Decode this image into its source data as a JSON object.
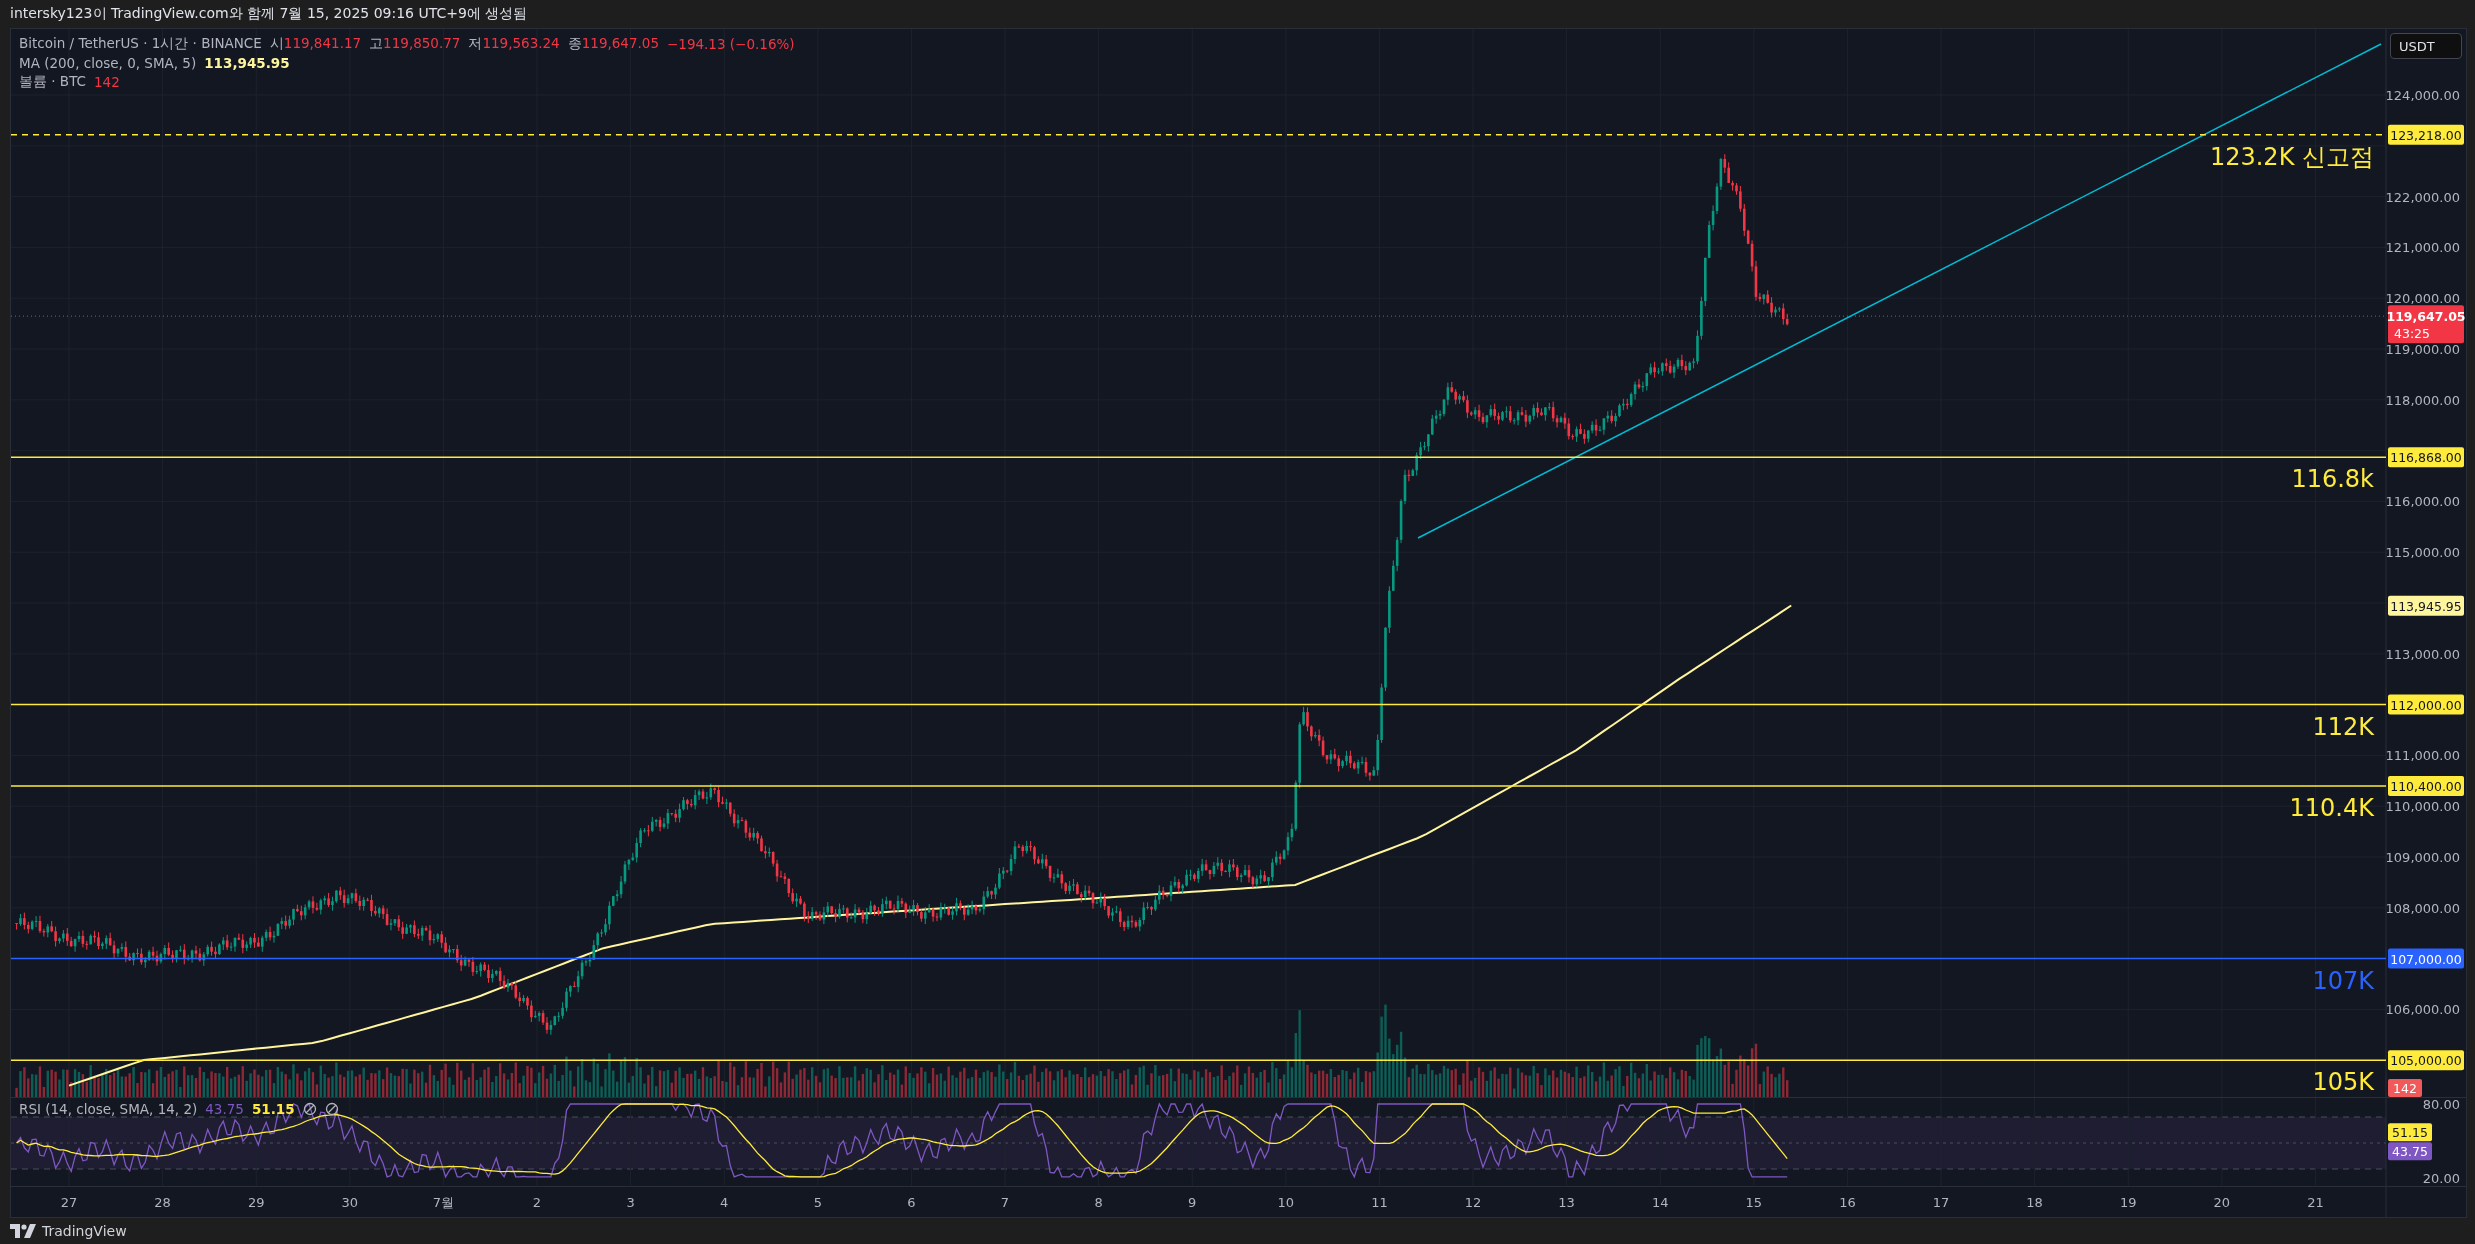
{
  "header": {
    "caption": "intersky123이 TradingView.com와 함께 7월 15, 2025 09:16 UTC+9에 생성됨"
  },
  "legend": {
    "symbol": "Bitcoin / TetherUS · 1시간 · BINANCE",
    "ohlc": [
      {
        "label": "시",
        "value": "119,841.17"
      },
      {
        "label": "고",
        "value": "119,850.77"
      },
      {
        "label": "저",
        "value": "119,563.24"
      },
      {
        "label": "종",
        "value": "119,647.05"
      }
    ],
    "change": "−194.13 (−0.16%)",
    "ma": {
      "label": "MA (200, close, 0, SMA, 5)",
      "value": "113,945.95"
    },
    "volume": {
      "label": "볼륨 · BTC",
      "value": "142"
    }
  },
  "price_axis": {
    "currency": "USDT",
    "ticks": [
      "124,000.00",
      "122,000.00",
      "121,000.00",
      "120,000.00",
      "119,000.00",
      "118,000.00",
      "116,000.00",
      "115,000.00",
      "113,000.00",
      "111,000.00",
      "110,000.00",
      "109,000.00",
      "108,000.00",
      "106,000.00"
    ]
  },
  "horizontal_lines": [
    {
      "label": "123.2K 신고점",
      "price_tag": "123,218.00",
      "color": "#ffeb3b"
    },
    {
      "label": "116.8k",
      "price_tag": "116,868.00",
      "color": "#ffeb3b"
    },
    {
      "label": "112K",
      "price_tag": "112,000.00",
      "color": "#ffeb3b"
    },
    {
      "label": "110.4K",
      "price_tag": "110,400.00",
      "color": "#ffeb3b"
    },
    {
      "label": "107K",
      "price_tag": "107,000.00",
      "color": "#2962ff"
    },
    {
      "label": "105K",
      "price_tag": "105,000.00",
      "color": "#ffeb3b"
    }
  ],
  "last_price": {
    "price": "119,647.05",
    "countdown": "43:25"
  },
  "ma_tag": "113,945.95",
  "volume_tag": "142",
  "rsi": {
    "label": "RSI (14, close, SMA, 14, 2)",
    "value": "43.75",
    "signal": "51.15",
    "value_tag": "43.75",
    "signal_tag": "51.15",
    "ticks": [
      "80.00",
      "20.00"
    ]
  },
  "time_axis": [
    "27",
    "28",
    "29",
    "30",
    "7월",
    "2",
    "3",
    "4",
    "5",
    "6",
    "7",
    "8",
    "9",
    "10",
    "11",
    "12",
    "13",
    "14",
    "15",
    "16",
    "17",
    "18",
    "19",
    "20",
    "21"
  ],
  "footer": {
    "brand": "TradingView"
  }
}
